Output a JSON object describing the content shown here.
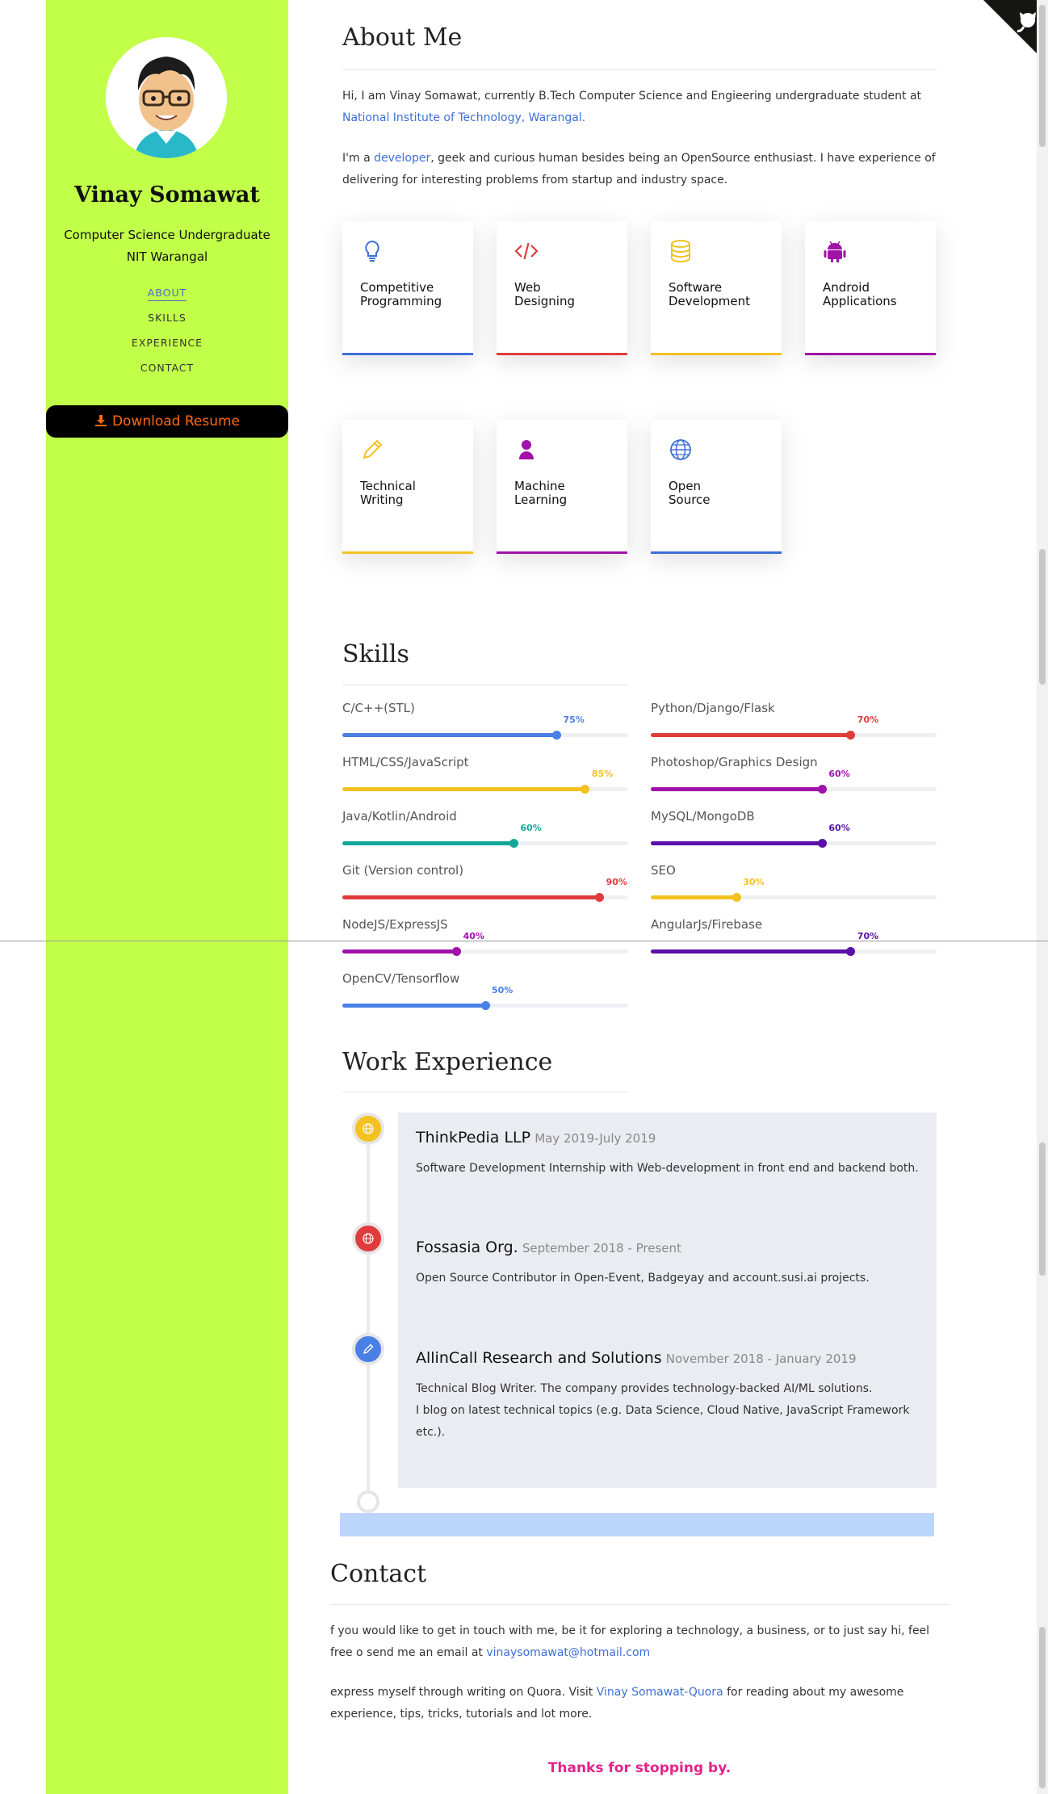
{
  "sidebar": {
    "name": "Vinay Somawat",
    "tagline_1": "Computer Science Undergraduate",
    "tagline_2": "NIT Warangal",
    "nav": [
      {
        "label": "ABOUT",
        "active": true
      },
      {
        "label": "SKILLS",
        "active": false
      },
      {
        "label": "EXPERIENCE",
        "active": false
      },
      {
        "label": "CONTACT",
        "active": false
      }
    ],
    "resume_icon": "download-icon",
    "resume_label": "Download Resume",
    "bg_color": "#c1ff48"
  },
  "about": {
    "title": "About Me",
    "p1_text": "Hi, I am Vinay Somawat, currently B.Tech Computer Science and Engieering undergraduate student at",
    "p1_link": "National Institute of Technology, Warangal.",
    "p2_pre": "I'm a ",
    "p2_link": "developer",
    "p2_post": ", geek and curious human besides being an OpenSource enthusiast. I have experience of delivering for interesting problems from startup and industry space.",
    "cards": [
      {
        "label": "Competitive\nProgramming",
        "icon": "lightbulb-icon",
        "color": "#3d6fd8"
      },
      {
        "label": "Web\nDesigning",
        "icon": "code-icon",
        "color": "#e03c3c"
      },
      {
        "label": "Software\nDevelopment",
        "icon": "database-icon",
        "color": "#f3c221"
      },
      {
        "label": "Android\nApplications",
        "icon": "android-icon",
        "color": "#a012a8"
      },
      {
        "label": "Technical\nWriting",
        "icon": "pencil-icon",
        "color": "#f3c221"
      },
      {
        "label": "Machine\nLearning",
        "icon": "user-icon",
        "color": "#a012a8"
      },
      {
        "label": "Open\nSource",
        "icon": "globe-icon",
        "color": "#3d6fd8"
      }
    ]
  },
  "skills": {
    "title": "Skills",
    "items": [
      {
        "name": "C/C++(STL)",
        "percent": 75,
        "label": "75%",
        "color": "#4a7fe6"
      },
      {
        "name": "Python/Django/Flask",
        "percent": 70,
        "label": "70%",
        "color": "#e03c3c"
      },
      {
        "name": "HTML/CSS/JavaScript",
        "percent": 85,
        "label": "85%",
        "color": "#f3c221"
      },
      {
        "name": "Photoshop/Graphics Design",
        "percent": 60,
        "label": "60%",
        "color": "#a012a8"
      },
      {
        "name": "Java/Kotlin/Android",
        "percent": 60,
        "label": "60%",
        "color": "#11a89a"
      },
      {
        "name": "MySQL/MongoDB",
        "percent": 60,
        "label": "60%",
        "color": "#5a10a8"
      },
      {
        "name": "Git (Version control)",
        "percent": 90,
        "label": "90%",
        "color": "#e03c3c"
      },
      {
        "name": "SEO",
        "percent": 30,
        "label": "30%",
        "color": "#f3c221"
      },
      {
        "name": "NodeJS/ExpressJS",
        "percent": 40,
        "label": "40%",
        "color": "#a012a8"
      },
      {
        "name": "AngularJs/Firebase",
        "percent": 70,
        "label": "70%",
        "color": "#5a10a8"
      },
      {
        "name": "OpenCV/Tensorflow",
        "percent": 50,
        "label": "50%",
        "color": "#4a7fe6"
      }
    ]
  },
  "experience": {
    "title": "Work Experience",
    "items": [
      {
        "company": "ThinkPedia LLP",
        "dates": "May 2019-July 2019",
        "desc": "Software Development Internship with Web-development in front end and backend both.",
        "icon": "globe-icon",
        "color": "#f3c221"
      },
      {
        "company": "Fossasia Org.",
        "dates": "September 2018 - Present",
        "desc": "Open Source Contributor in Open-Event, Badgeyay and account.susi.ai projects.",
        "icon": "globe-icon",
        "color": "#e03c3c"
      },
      {
        "company": "AllinCall Research and Solutions",
        "dates": "November 2018 - January 2019",
        "desc": "Technical Blog Writer. The company provides technology-backed AI/ML solutions.\nI blog on latest technical topics (e.g. Data Science, Cloud Native, JavaScript Framework etc.).",
        "icon": "pencil-icon",
        "color": "#4a7fe6"
      }
    ]
  },
  "contact": {
    "title": "Contact",
    "p1_text": "f you would like to get in touch with me, be it for exploring a technology, a business, or to just say hi, feel free o send me an email at",
    "email": "vinaysomawat@hotmail.com",
    "p2_pre": "express myself through writing on Quora. Visit",
    "quora_link": "Vinay Somawat-Quora",
    "p2_post": "for reading about my awesome experience, tips, tricks, tutorials and lot more.",
    "thanks": "Thanks for stopping by."
  }
}
